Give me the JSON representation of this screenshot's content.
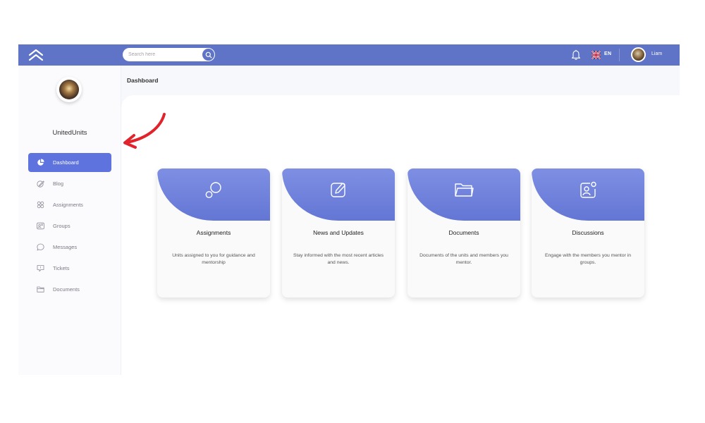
{
  "topbar": {
    "search_placeholder": "Search here",
    "language": "EN",
    "username": "Liam"
  },
  "sidebar": {
    "org_name": "UnitedUnits",
    "items": [
      {
        "label": "Dashboard",
        "icon": "pie-chart-icon",
        "active": true
      },
      {
        "label": "Blog",
        "icon": "pencil-icon",
        "active": false
      },
      {
        "label": "Assignments",
        "icon": "assignments-icon",
        "active": false
      },
      {
        "label": "Groups",
        "icon": "groups-icon",
        "active": false
      },
      {
        "label": "Messages",
        "icon": "chat-bubble-icon",
        "active": false
      },
      {
        "label": "Tickets",
        "icon": "ticket-icon",
        "active": false
      },
      {
        "label": "Documents",
        "icon": "folder-icon",
        "active": false
      }
    ]
  },
  "main": {
    "page_title": "Dashboard",
    "cards": [
      {
        "title": "Assignments",
        "description": "Units assigned to you for guidance and mentorship",
        "icon": "bubbles-icon"
      },
      {
        "title": "News and Updates",
        "description": "Stay informed with the most recent articles and news.",
        "icon": "edit-icon"
      },
      {
        "title": "Documents",
        "description": "Documents of the units and members you mentor.",
        "icon": "folder-icon"
      },
      {
        "title": "Discussions",
        "description": "Engage with the members you mentor in groups.",
        "icon": "user-card-icon"
      }
    ]
  },
  "colors": {
    "primary": "#5f73c7",
    "active_nav": "#5f73de",
    "card_header": "#6f82dc",
    "annotation_arrow": "#e1232b"
  }
}
